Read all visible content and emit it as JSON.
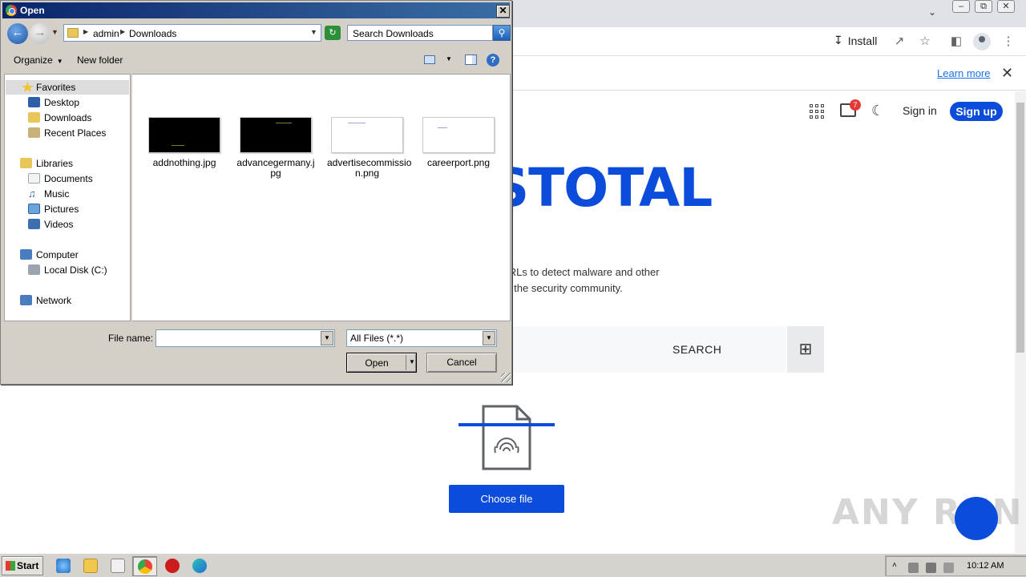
{
  "browser": {
    "toolbar": {
      "install_label": "Install"
    },
    "infobar": {
      "learn_more": "Learn more"
    }
  },
  "virustotal": {
    "header": {
      "notification_count": "7",
      "sign_in": "Sign in",
      "sign_up": "Sign up"
    },
    "logo_text": "USTOTAL",
    "description_line1": "and URLs to detect malware and other",
    "description_line2": "m with the security community.",
    "search_label": "SEARCH",
    "choose_file": "Choose file"
  },
  "watermark": "ANY RUN",
  "dialog": {
    "title": "Open",
    "breadcrumb": [
      "admin",
      "Downloads"
    ],
    "search_placeholder": "Search Downloads",
    "commands": {
      "organize": "Organize",
      "new_folder": "New folder"
    },
    "nav_tree": {
      "favorites": {
        "label": "Favorites",
        "items": [
          "Desktop",
          "Downloads",
          "Recent Places"
        ]
      },
      "libraries": {
        "label": "Libraries",
        "items": [
          "Documents",
          "Music",
          "Pictures",
          "Videos"
        ]
      },
      "computer": {
        "label": "Computer",
        "items": [
          "Local Disk (C:)"
        ]
      },
      "network": {
        "label": "Network"
      }
    },
    "files": [
      {
        "name_line1": "addnothing.jpg",
        "name_line2": "",
        "thumb": "dark"
      },
      {
        "name_line1": "advancegermany.j",
        "name_line2": "pg",
        "thumb": "dark"
      },
      {
        "name_line1": "advertisecommissio",
        "name_line2": "n.png",
        "thumb": "light"
      },
      {
        "name_line1": "careerport.png",
        "name_line2": "",
        "thumb": "light"
      }
    ],
    "file_name_label": "File name:",
    "file_name_value": "",
    "file_type": "All Files (*.*)",
    "open_button": "Open",
    "cancel_button": "Cancel"
  },
  "taskbar": {
    "start": "Start",
    "clock": "10:12 AM"
  },
  "colors": {
    "vt_blue": "#0b4dda",
    "title_bar": "#0a246a",
    "dialog_face": "#d4d0c8"
  }
}
